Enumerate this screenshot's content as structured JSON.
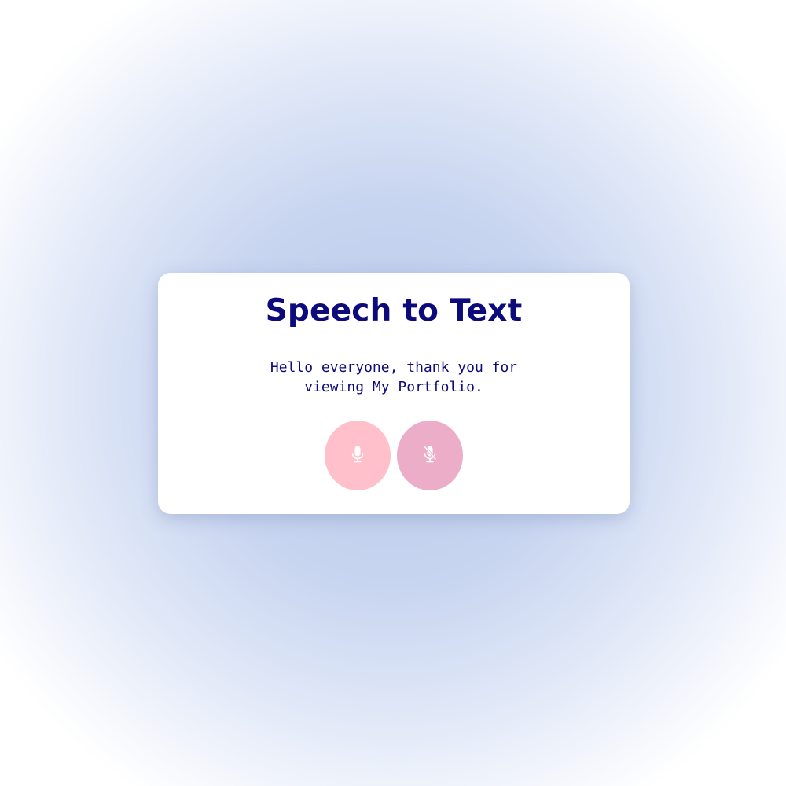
{
  "card": {
    "title": "Speech to Text",
    "transcript": "Hello everyone, thank you for viewing My Portfolio."
  },
  "buttons": {
    "start": {
      "icon": "microphone-icon",
      "color": "#ffc0cc"
    },
    "stop": {
      "icon": "microphone-slash-icon",
      "color": "#ecadc9"
    }
  },
  "colors": {
    "text": "#0d0a7c",
    "card_background": "#ffffff",
    "page_background": "#c8d5f0"
  }
}
